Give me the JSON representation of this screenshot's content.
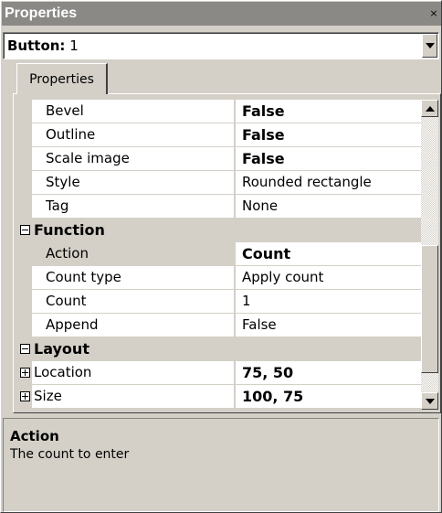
{
  "window": {
    "title": "Properties",
    "close_glyph": "×"
  },
  "selector": {
    "label_bold": "Button:",
    "value": " 1"
  },
  "tab": {
    "label": "Properties"
  },
  "grid": {
    "rows": [
      {
        "type": "prop",
        "name": "Bevel",
        "value": "False",
        "bold": true
      },
      {
        "type": "prop",
        "name": "Outline",
        "value": "False",
        "bold": true
      },
      {
        "type": "prop",
        "name": "Scale image",
        "value": "False",
        "bold": true
      },
      {
        "type": "prop",
        "name": "Style",
        "value": "Rounded rectangle",
        "bold": false
      },
      {
        "type": "prop",
        "name": "Tag",
        "value": "None",
        "bold": false
      },
      {
        "type": "category",
        "name": "Function",
        "expanded": true
      },
      {
        "type": "prop",
        "name": "Action",
        "value": "Count",
        "bold": true,
        "selected": true
      },
      {
        "type": "prop",
        "name": "Count type",
        "value": "Apply count",
        "bold": false
      },
      {
        "type": "prop",
        "name": "Count",
        "value": "1",
        "bold": false
      },
      {
        "type": "prop",
        "name": "Append",
        "value": "False",
        "bold": false
      },
      {
        "type": "category",
        "name": "Layout",
        "expanded": true
      },
      {
        "type": "prop",
        "name": "Location",
        "value": "75, 50",
        "bold": true,
        "expandable": true
      },
      {
        "type": "prop",
        "name": "Size",
        "value": "100, 75",
        "bold": true,
        "expandable": true
      }
    ]
  },
  "help": {
    "title": "Action",
    "description": "The count to enter"
  },
  "colors": {
    "titlebar": "#8a8986",
    "face": "#d4d0c8",
    "cell": "#ffffff"
  }
}
